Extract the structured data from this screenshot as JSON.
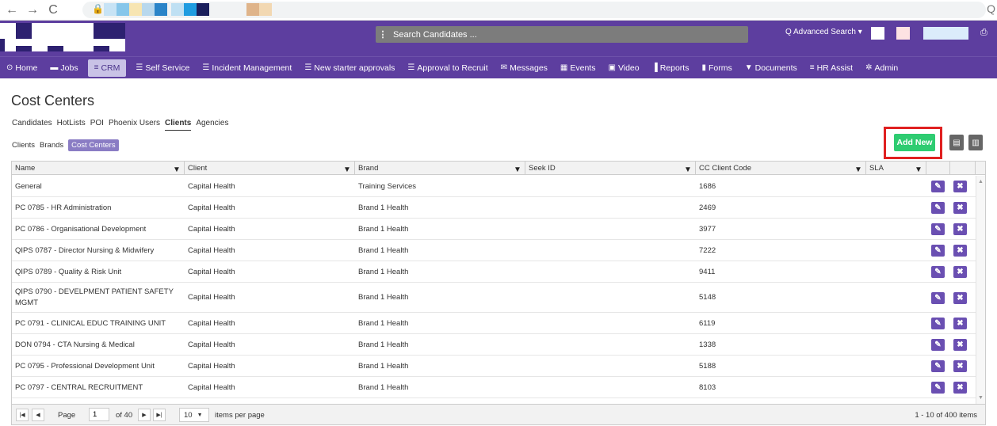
{
  "browser": {
    "back_icon": "←",
    "forward_icon": "→",
    "reload_icon": "C",
    "lock_icon": "🔒",
    "zoom_icon": "Q"
  },
  "header": {
    "search_menu_icon": "⋮",
    "search_placeholder": "Search Candidates ...",
    "advanced_search": "Q Advanced Search ▾",
    "print_icon": "⎙"
  },
  "nav": {
    "items": [
      {
        "icon": "⊙",
        "label": "Home"
      },
      {
        "icon": "▬",
        "label": "Jobs"
      },
      {
        "icon": "≡",
        "label": "CRM"
      },
      {
        "icon": "☰",
        "label": "Self Service"
      },
      {
        "icon": "☰",
        "label": "Incident Management"
      },
      {
        "icon": "☰",
        "label": "New starter approvals"
      },
      {
        "icon": "☰",
        "label": "Approval to Recruit"
      },
      {
        "icon": "✉",
        "label": "Messages"
      },
      {
        "icon": "▦",
        "label": "Events"
      },
      {
        "icon": "▣",
        "label": "Video"
      },
      {
        "icon": "▐",
        "label": "Reports"
      },
      {
        "icon": "▮",
        "label": "Forms"
      },
      {
        "icon": "▼",
        "label": "Documents"
      },
      {
        "icon": "≡",
        "label": "HR Assist"
      },
      {
        "icon": "✲",
        "label": "Admin"
      }
    ]
  },
  "page": {
    "title": "Cost Centers",
    "tabs": [
      "Candidates",
      "HotLists",
      "POI",
      "Phoenix Users",
      "Clients",
      "Agencies"
    ],
    "subtabs": [
      "Clients",
      "Brands",
      "Cost Centers"
    ],
    "add_new": "Add New",
    "export_icons": [
      "▤",
      "▥"
    ]
  },
  "grid": {
    "columns": [
      "Name",
      "Client",
      "Brand",
      "Seek ID",
      "CC Client Code",
      "SLA"
    ],
    "filter_icon": "▼",
    "edit_icon": "✎",
    "delete_icon": "✖",
    "rows": [
      {
        "name": "General",
        "client": "Capital Health",
        "brand": "Training Services",
        "seek": "",
        "code": "1686",
        "sla": ""
      },
      {
        "name": "PC 0785 - HR Administration",
        "client": "Capital Health",
        "brand": "Brand 1 Health",
        "seek": "",
        "code": "2469",
        "sla": ""
      },
      {
        "name": "PC 0786 - Organisational Development",
        "client": "Capital Health",
        "brand": "Brand 1 Health",
        "seek": "",
        "code": "3977",
        "sla": ""
      },
      {
        "name": "QIPS 0787 - Director Nursing & Midwifery",
        "client": "Capital Health",
        "brand": "Brand 1 Health",
        "seek": "",
        "code": "7222",
        "sla": ""
      },
      {
        "name": "QIPS 0789 - Quality & Risk Unit",
        "client": "Capital Health",
        "brand": "Brand 1 Health",
        "seek": "",
        "code": "9411",
        "sla": ""
      },
      {
        "name": "QIPS 0790 - DEVELPMENT PATIENT SAFETY MGMT",
        "client": "Capital Health",
        "brand": "Brand 1 Health",
        "seek": "",
        "code": "5148",
        "sla": ""
      },
      {
        "name": "PC 0791 - CLINICAL EDUC TRAINING UNIT",
        "client": "Capital Health",
        "brand": "Brand 1 Health",
        "seek": "",
        "code": "6119",
        "sla": ""
      },
      {
        "name": "DON 0794 - CTA Nursing & Medical",
        "client": "Capital Health",
        "brand": "Brand 1 Health",
        "seek": "",
        "code": "1338",
        "sla": ""
      },
      {
        "name": "PC 0795 - Professional Development Unit",
        "client": "Capital Health",
        "brand": "Brand 1 Health",
        "seek": "",
        "code": "5188",
        "sla": ""
      },
      {
        "name": "PC 0797 - CENTRAL RECRUITMENT",
        "client": "Capital Health",
        "brand": "Brand 1 Health",
        "seek": "",
        "code": "8103",
        "sla": ""
      }
    ],
    "scroll_up": "▲",
    "scroll_down": "▼"
  },
  "pager": {
    "first_icon": "|◀",
    "prev_icon": "◀",
    "next_icon": "▶",
    "last_icon": "▶|",
    "page_label": "Page",
    "page_value": "1",
    "of_label": "of 40",
    "page_size": "10",
    "page_size_caret": "▼",
    "items_per_page": "items per page",
    "summary": "1 - 10 of 400 items"
  }
}
